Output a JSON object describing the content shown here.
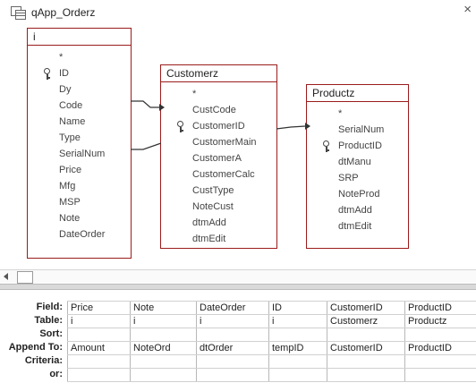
{
  "window": {
    "title": "qApp_Orderz",
    "close_glyph": "×",
    "icon": "query-design-icon"
  },
  "tables": {
    "i": {
      "name": "i",
      "fields": [
        "*",
        "ID",
        "Dy",
        "Code",
        "Name",
        "Type",
        "SerialNum",
        "Price",
        "Mfg",
        "MSP",
        "Note",
        "DateOrder"
      ],
      "key_field": "ID"
    },
    "customerz": {
      "name": "Customerz",
      "fields": [
        "*",
        "CustCode",
        "CustomerID",
        "CustomerMain",
        "CustomerA",
        "CustomerCalc",
        "CustType",
        "NoteCust",
        "dtmAdd",
        "dtmEdit"
      ],
      "key_field": "CustomerID"
    },
    "productz": {
      "name": "Productz",
      "fields": [
        "*",
        "SerialNum",
        "ProductID",
        "dtManu",
        "SRP",
        "NoteProd",
        "dtmAdd",
        "dtmEdit"
      ],
      "key_field": "ProductID"
    }
  },
  "grid": {
    "row_labels": [
      "Field:",
      "Table:",
      "Sort:",
      "Append To:",
      "Criteria:",
      "or:"
    ],
    "columns": [
      {
        "field": "Price",
        "table": "i",
        "sort": "",
        "append_to": "Amount",
        "criteria": "",
        "or": ""
      },
      {
        "field": "Note",
        "table": "i",
        "sort": "",
        "append_to": "NoteOrd",
        "criteria": "",
        "or": ""
      },
      {
        "field": "DateOrder",
        "table": "i",
        "sort": "",
        "append_to": "dtOrder",
        "criteria": "",
        "or": ""
      },
      {
        "field": "ID",
        "table": "i",
        "sort": "",
        "append_to": "tempID",
        "criteria": "",
        "or": ""
      },
      {
        "field": "CustomerID",
        "table": "Customerz",
        "sort": "",
        "append_to": "CustomerID",
        "criteria": "",
        "or": ""
      },
      {
        "field": "ProductID",
        "table": "Productz",
        "sort": "",
        "append_to": "ProductID",
        "criteria": "",
        "or": ""
      }
    ]
  },
  "colors": {
    "table_border": "#9b1c1c",
    "join_line": "#333333"
  }
}
